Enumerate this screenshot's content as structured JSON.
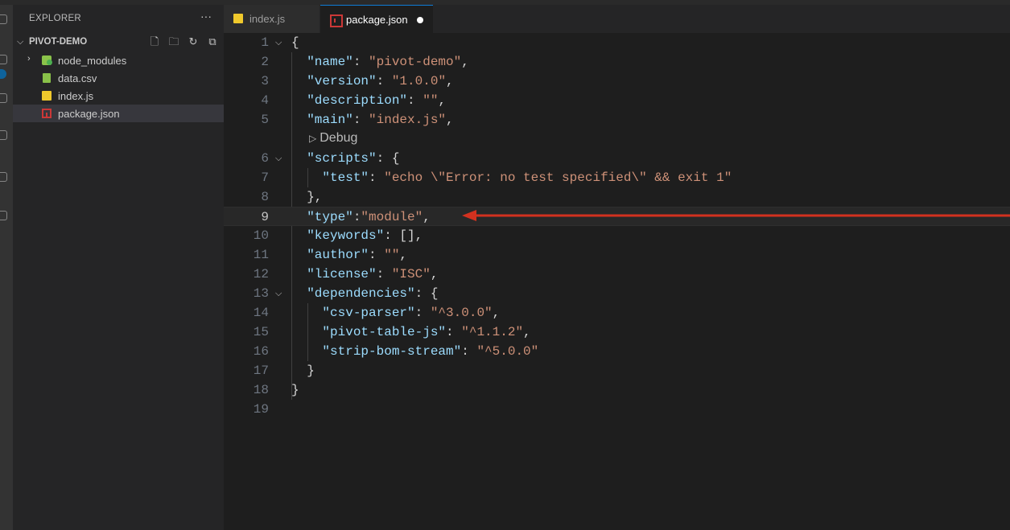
{
  "explorer": {
    "title": "EXPLORER",
    "more_label": "···",
    "project": "PIVOT-DEMO",
    "actions": [
      "new-file-icon",
      "new-folder-icon",
      "refresh-icon",
      "collapse-all-icon"
    ],
    "files": [
      {
        "label": "node_modules",
        "icon": "folder-icon"
      },
      {
        "label": "data.csv",
        "icon": "csv-file-icon"
      },
      {
        "label": "index.js",
        "icon": "js-file-icon"
      },
      {
        "label": "package.json",
        "icon": "npm-file-icon"
      }
    ]
  },
  "tabs": [
    {
      "label": "index.js",
      "icon": "js-file-icon"
    },
    {
      "label": "package.json",
      "icon": "npm-file-icon",
      "modified": true
    }
  ],
  "editor": {
    "codelens": "Debug",
    "current_line": 9,
    "line_numbers": [
      "1",
      "2",
      "3",
      "4",
      "5",
      "6",
      "7",
      "8",
      "9",
      "10",
      "11",
      "12",
      "13",
      "14",
      "15",
      "16",
      "17",
      "18",
      "19"
    ],
    "lines": {
      "l1": "{",
      "l2k": "\"name\"",
      "l2v": "\"pivot-demo\"",
      "l3k": "\"version\"",
      "l3v": "\"1.0.0\"",
      "l4k": "\"description\"",
      "l4v": "\"\"",
      "l5k": "\"main\"",
      "l5v": "\"index.js\"",
      "l6k": "\"scripts\"",
      "l7k": "\"test\"",
      "l7v": "\"echo \\\"Error: no test specified\\\" && exit 1\"",
      "l8": "},",
      "l9k": "\"type\"",
      "l9v": "\"module\"",
      "l10k": "\"keywords\"",
      "l11k": "\"author\"",
      "l11v": "\"\"",
      "l12k": "\"license\"",
      "l12v": "\"ISC\"",
      "l13k": "\"dependencies\"",
      "l14k": "\"csv-parser\"",
      "l14v": "\"^3.0.0\"",
      "l15k": "\"pivot-table-js\"",
      "l15v": "\"^1.1.2\"",
      "l16k": "\"strip-bom-stream\"",
      "l16v": "\"^5.0.0\"",
      "l17": "}",
      "l18": "}"
    }
  },
  "colors": {
    "annotation_arrow": "#d2311f",
    "tab_accent": "#0e7cd6"
  }
}
